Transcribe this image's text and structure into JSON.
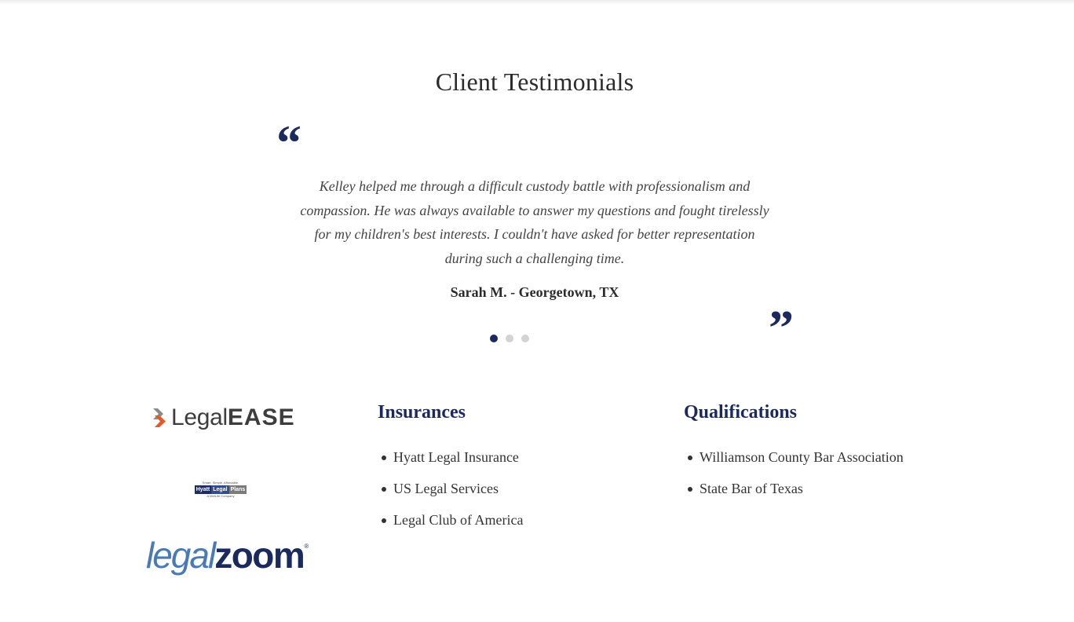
{
  "testimonials": {
    "title": "Client Testimonials",
    "open_quote": "“",
    "close_quote": "”",
    "current": {
      "text": "Kelley helped me through a difficult custody battle with professionalism and compassion. He was always available to answer my questions and fought tirelessly for my children's best interests. I couldn't have asked for better representation during such a challenging time.",
      "author": "Sarah M. - Georgetown, TX"
    },
    "slide_count": 3,
    "active_slide": 1
  },
  "logos": {
    "legalease": {
      "prefix": "Legal",
      "suffix": "EASE"
    },
    "hyatt": {
      "tagline": "Smart. Simple. Affordable.",
      "words": [
        "Hyatt",
        "Legal",
        "Plans"
      ],
      "subtitle": "A MetLife Company"
    },
    "legalzoom": {
      "part1": "legal",
      "part2": "zoom",
      "mark": "®"
    }
  },
  "insurances": {
    "heading": "Insurances",
    "items": [
      "Hyatt Legal Insurance",
      "US Legal Services",
      "Legal Club of America"
    ]
  },
  "qualifications": {
    "heading": "Qualifications",
    "items": [
      "Williamson County Bar Association",
      "State Bar of Texas"
    ]
  },
  "colors": {
    "accent": "#1b2a5e",
    "dot_inactive": "#d3d3d3",
    "text": "#333333"
  }
}
